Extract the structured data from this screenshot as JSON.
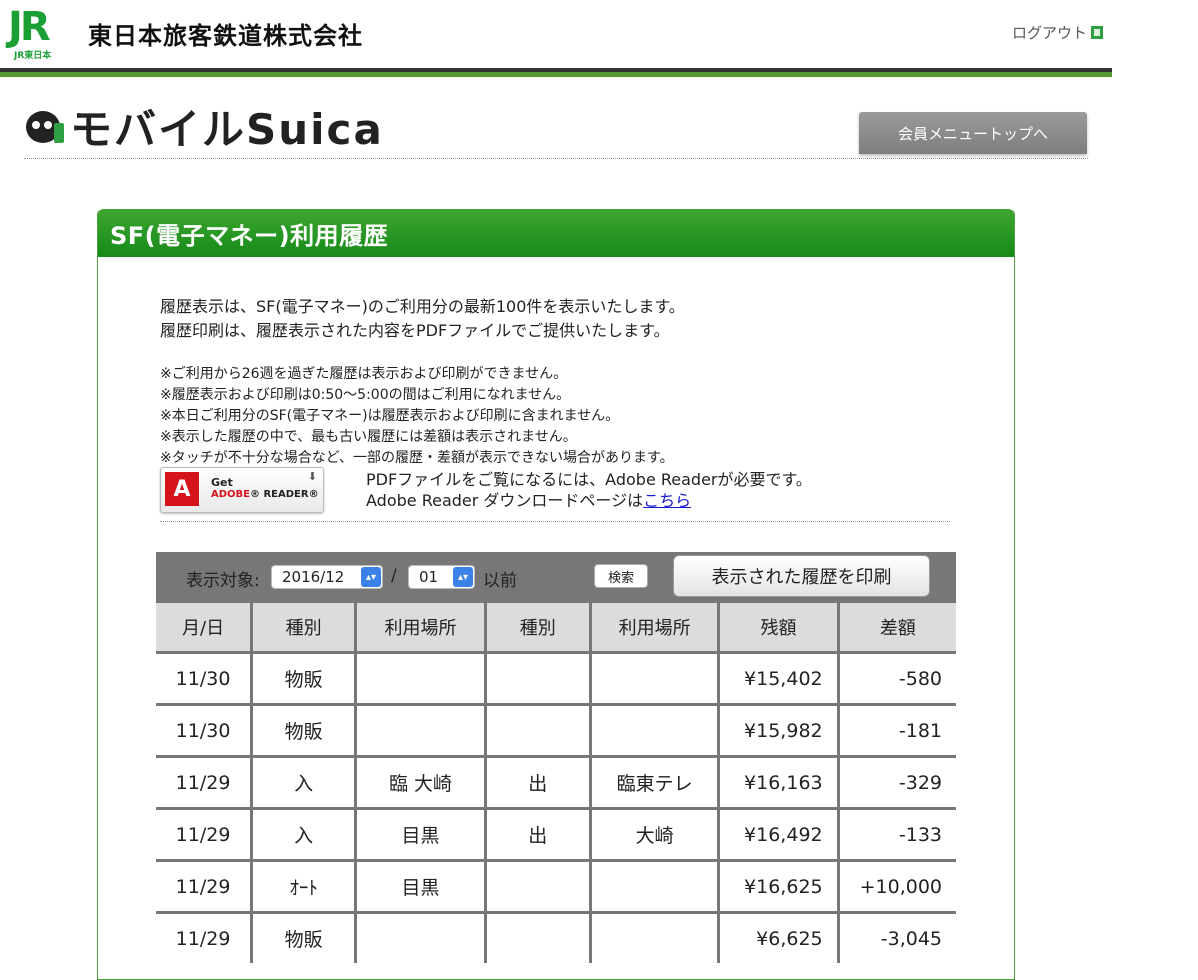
{
  "header": {
    "jr_mark": "JR",
    "jr_sub": "JR東日本",
    "company": "東日本旅客鉄道株式会社",
    "logout": "ログアウト"
  },
  "brand": {
    "suica": "モバイルSuica",
    "member_top": "会員メニュートップへ"
  },
  "panel": {
    "title": "SF(電子マネー)利用履歴",
    "intro": [
      "履歴表示は、SF(電子マネー)のご利用分の最新100件を表示いたします。",
      "履歴印刷は、履歴表示された内容をPDFファイルでご提供いたします。"
    ],
    "notes": [
      "※ご利用から26週を過ぎた履歴は表示および印刷ができません。",
      "※履歴表示および印刷は0:50〜5:00の間はご利用になれません。",
      "※本日ご利用分のSF(電子マネー)は履歴表示および印刷に含まれません。",
      "※表示した履歴の中で、最も古い履歴には差額は表示されません。",
      "※タッチが不十分な場合など、一部の履歴・差額が表示できない場合があります。"
    ],
    "adobe": {
      "get": "Get",
      "brand": "ADOBE",
      "product": "READER",
      "line1": "PDFファイルをご覧になるには、Adobe Readerが必要です。",
      "line2": "Adobe Reader ダウンロードページは",
      "link": "こちら"
    }
  },
  "controls": {
    "target_label": "表示対象:",
    "month": "2016/12",
    "day": "01",
    "slash": "/",
    "before": "以前",
    "search": "検索",
    "print": "表示された履歴を印刷"
  },
  "table": {
    "headers": [
      "月/日",
      "種別",
      "利用場所",
      "種別",
      "利用場所",
      "残額",
      "差額"
    ],
    "rows": [
      [
        "11/30",
        "物販",
        "",
        "",
        "",
        "¥15,402",
        "-580"
      ],
      [
        "11/30",
        "物販",
        "",
        "",
        "",
        "¥15,982",
        "-181"
      ],
      [
        "11/29",
        "入",
        "臨 大崎",
        "出",
        "臨東テレ",
        "¥16,163",
        "-329"
      ],
      [
        "11/29",
        "入",
        "目黒",
        "出",
        "大崎",
        "¥16,492",
        "-133"
      ],
      [
        "11/29",
        "ｵｰﾄ",
        "目黒",
        "",
        "",
        "¥16,625",
        "+10,000"
      ],
      [
        "11/29",
        "物販",
        "",
        "",
        "",
        "¥6,625",
        "-3,045"
      ]
    ]
  }
}
